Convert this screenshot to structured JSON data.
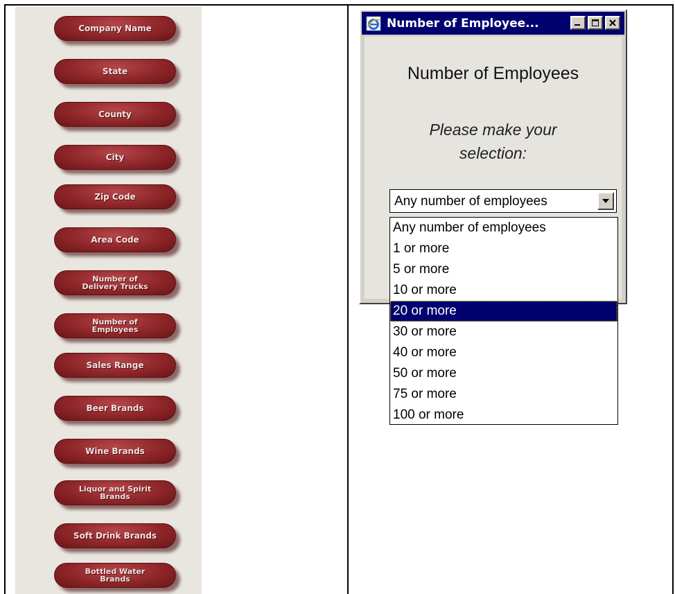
{
  "sidebar": {
    "buttons": [
      {
        "label": "Company Name"
      },
      {
        "label": "State"
      },
      {
        "label": "County"
      },
      {
        "label": "City"
      },
      {
        "label": "Zip Code"
      },
      {
        "label": "Area Code"
      },
      {
        "line1": "Number of",
        "line2": "Delivery Trucks"
      },
      {
        "line1": "Number of",
        "line2": "Employees"
      },
      {
        "label": "Sales Range"
      },
      {
        "label": "Beer Brands"
      },
      {
        "label": "Wine Brands"
      },
      {
        "line1": "Liquor and Spirit",
        "line2": "Brands"
      },
      {
        "label": "Soft Drink Brands"
      },
      {
        "line1": "Bottled Water",
        "line2": "Brands"
      }
    ]
  },
  "popup": {
    "title": "Number of Employee...",
    "heading": "Number of Employees",
    "prompt_line1": "Please make your",
    "prompt_line2": "selection:",
    "select": {
      "value": "Any number of employees",
      "options": [
        "Any number of employees",
        "1 or more",
        "5 or more",
        "10 or more",
        "20 or more",
        "30 or more",
        "40 or more",
        "50 or more",
        "75 or more",
        "100 or more"
      ],
      "highlighted": "20 or more"
    }
  },
  "colors": {
    "button_red": "#8e2629",
    "titlebar_blue": "#00006e",
    "sidebar_bg": "#e9e6e0"
  }
}
